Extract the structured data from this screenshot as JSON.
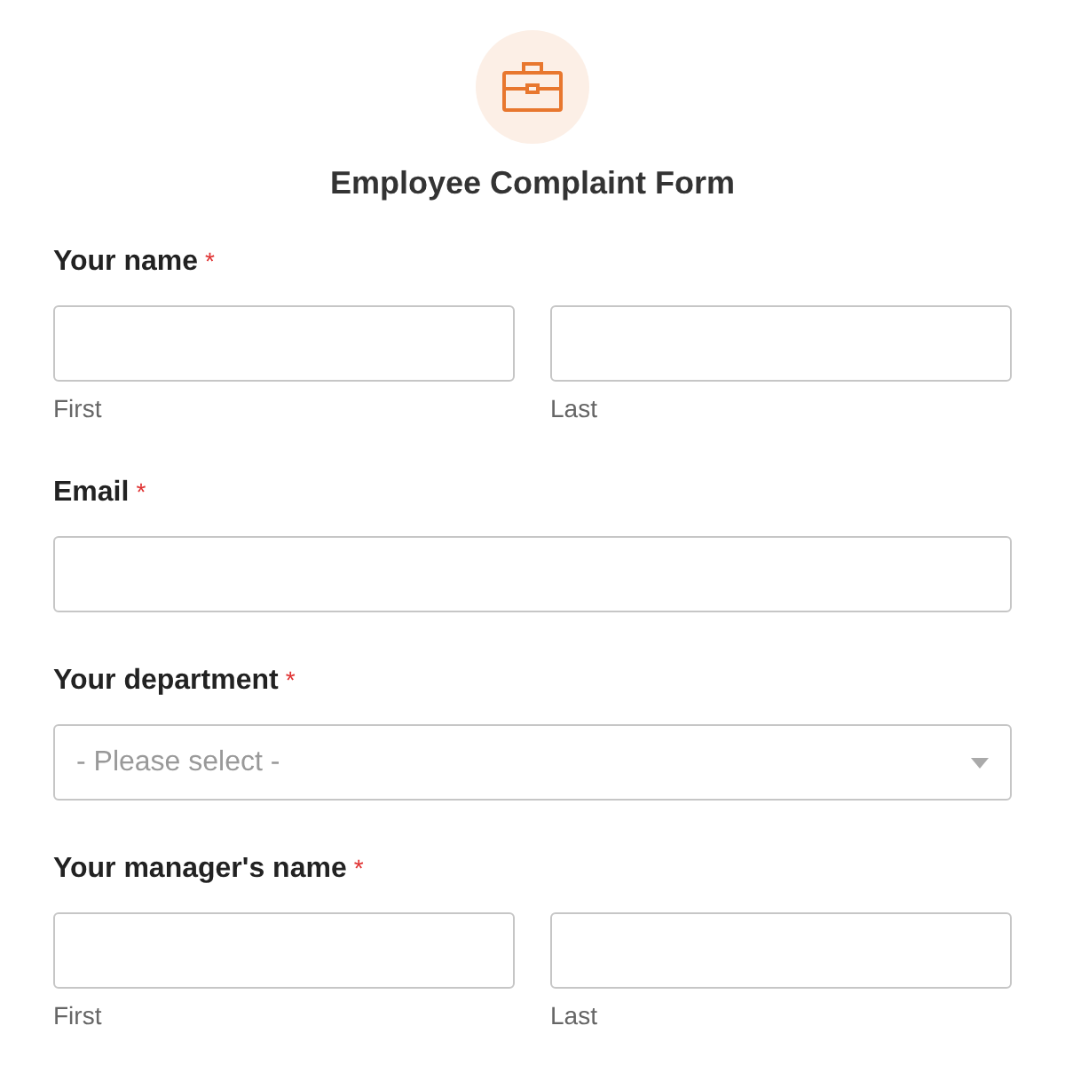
{
  "form": {
    "title": "Employee Complaint Form"
  },
  "fields": [
    {
      "kind": "name",
      "label": "Your name",
      "required_mark": "*",
      "parts": [
        {
          "sublabel": "First"
        },
        {
          "sublabel": "Last"
        }
      ]
    },
    {
      "kind": "text",
      "label": "Email",
      "required_mark": "*"
    },
    {
      "kind": "select",
      "label": "Your department",
      "required_mark": "*",
      "placeholder": "- Please select -"
    },
    {
      "kind": "name",
      "label": "Your manager's name",
      "required_mark": "*",
      "parts": [
        {
          "sublabel": "First"
        },
        {
          "sublabel": "Last"
        }
      ]
    }
  ]
}
